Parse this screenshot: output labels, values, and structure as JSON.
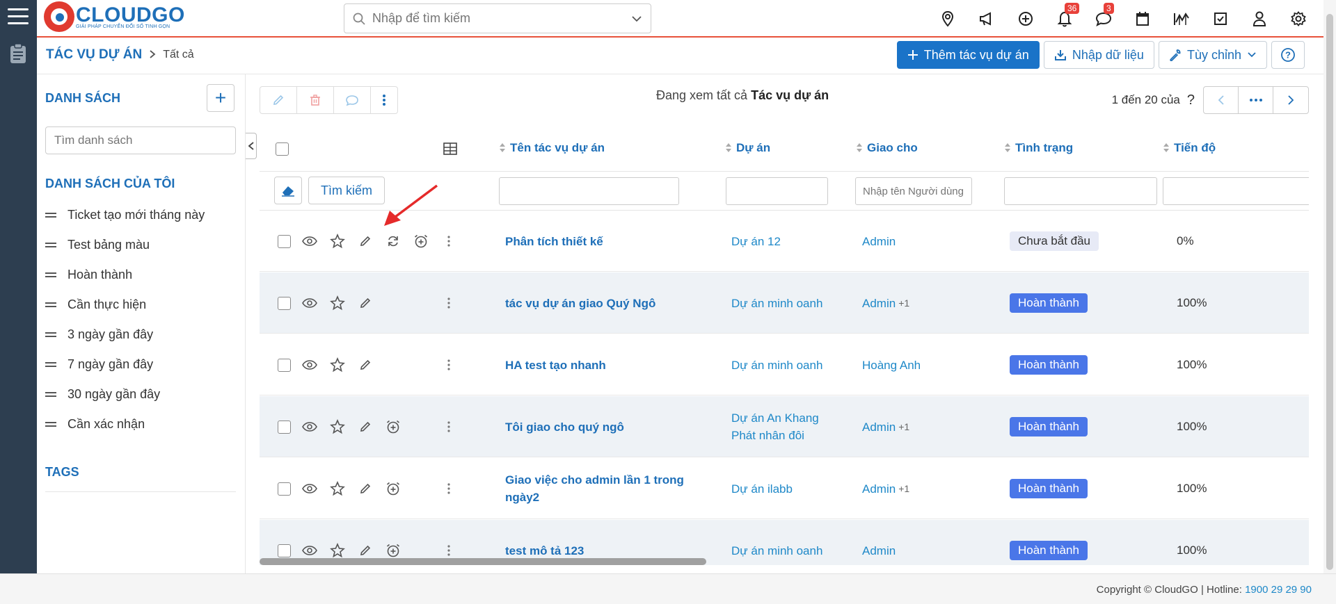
{
  "brand": {
    "name": "CLOUDGO",
    "tagline": "GIẢI PHÁP CHUYỂN ĐỔI SỐ TINH GỌN",
    "accent": "#1e6fb8",
    "logo_color": "#e03a2f"
  },
  "search": {
    "placeholder": "Nhập để tìm kiếm"
  },
  "top_icons": [
    {
      "icon": "location-pin-icon"
    },
    {
      "icon": "megaphone-icon"
    },
    {
      "icon": "add-circle-icon"
    },
    {
      "icon": "bell-icon",
      "badge": "36"
    },
    {
      "icon": "chat-icon",
      "badge": "3"
    },
    {
      "icon": "calendar-icon"
    },
    {
      "icon": "chart-icon"
    },
    {
      "icon": "checkbox-icon"
    },
    {
      "icon": "user-icon"
    },
    {
      "icon": "gear-icon"
    }
  ],
  "breadcrumb": {
    "main": "TÁC VỤ DỰ ÁN",
    "current": "Tất cả"
  },
  "actions": {
    "add": "Thêm tác vụ dự án",
    "import": "Nhập dữ liệu",
    "customize": "Tùy chỉnh"
  },
  "sidebar": {
    "title": "DANH SÁCH",
    "filter_placeholder": "Tìm danh sách",
    "my_lists_title": "DANH SÁCH CỦA TÔI",
    "items": [
      "Ticket tạo mới tháng này",
      "Test bảng màu",
      "Hoàn thành",
      "Cần thực hiện",
      "3 ngày gần đây",
      "7 ngày gần đây",
      "30 ngày gần đây",
      "Cần xác nhận"
    ],
    "tags_title": "TAGS"
  },
  "viewing": {
    "prefix": "Đang xem tất cả",
    "module": "Tác vụ dự án"
  },
  "pager": {
    "count": "1 đến 20 của",
    "help": "?"
  },
  "table": {
    "columns": {
      "name": "Tên tác vụ dự án",
      "project": "Dự án",
      "assignee": "Giao cho",
      "status": "Tình trạng",
      "progress": "Tiến độ"
    },
    "filter_button": "Tìm kiếm",
    "assignee_placeholder": "Nhập tên Người dùng hoặc",
    "rows": [
      {
        "name": "Phân tích thiết kế",
        "project": "Dự án 12",
        "assignee": "Admin",
        "extra": "",
        "status": "Chưa bắt đầu",
        "status_kind": "todo",
        "progress": "0%"
      },
      {
        "name": "tác vụ dự án giao Quý Ngô",
        "project": "Dự án minh oanh",
        "assignee": "Admin",
        "extra": "+1",
        "status": "Hoàn thành",
        "status_kind": "done",
        "progress": "100%"
      },
      {
        "name": "HA test tạo nhanh",
        "project": "Dự án minh oanh",
        "assignee": "Hoàng Anh",
        "extra": "",
        "status": "Hoàn thành",
        "status_kind": "done",
        "progress": "100%"
      },
      {
        "name": "Tôi giao cho quý ngô",
        "project": "Dự án An Khang Phát nhân đôi",
        "assignee": "Admin",
        "extra": "+1",
        "status": "Hoàn thành",
        "status_kind": "done",
        "progress": "100%"
      },
      {
        "name": "Giao việc cho admin lần 1 trong ngày2",
        "project": "Dự án ilabb",
        "assignee": "Admin",
        "extra": "+1",
        "status": "Hoàn thành",
        "status_kind": "done",
        "progress": "100%"
      },
      {
        "name": "test mô tả 123",
        "project": "Dự án minh oanh",
        "assignee": "Admin",
        "extra": "",
        "status": "Hoàn thành",
        "status_kind": "done",
        "progress": "100%"
      }
    ]
  },
  "footer": {
    "copyright": "Copyright © CloudGO",
    "hotline_label": "Hotline:",
    "hotline": "1900 29 29 90"
  }
}
